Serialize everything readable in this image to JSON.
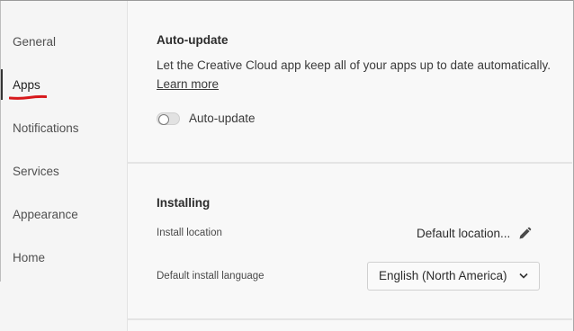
{
  "sidebar": {
    "items": [
      {
        "label": "General"
      },
      {
        "label": "Apps"
      },
      {
        "label": "Notifications"
      },
      {
        "label": "Services"
      },
      {
        "label": "Appearance"
      },
      {
        "label": "Home"
      }
    ],
    "selected": "Apps"
  },
  "auto_update": {
    "title": "Auto-update",
    "description": "Let the Creative Cloud app keep all of your apps up to date automatically.",
    "link": "Learn more",
    "toggle_label": "Auto-update",
    "toggle_on": false
  },
  "installing": {
    "title": "Installing",
    "location_label": "Install location",
    "location_value": "Default location...",
    "language_label": "Default install language",
    "language_value": "English (North America)"
  },
  "colors": {
    "selection_underline": "#d7191c"
  }
}
